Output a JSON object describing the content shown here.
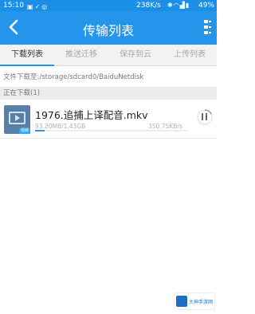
{
  "status_bar": {
    "time": "15:10",
    "network_rate": "238K/s",
    "battery": "49%",
    "left_icons": [
      "image-icon",
      "check-icon",
      "chat-icon"
    ],
    "right_icons": [
      "bluetooth-icon",
      "wifi-icon",
      "signal-icon",
      "battery-icon"
    ]
  },
  "header": {
    "title": "传输列表",
    "back_icon": "back-chevron-icon",
    "more_icon": "more-icon"
  },
  "tabs": [
    {
      "label": "下载列表",
      "active": true
    },
    {
      "label": "推送迁移",
      "active": false
    },
    {
      "label": "保存到云",
      "active": false
    },
    {
      "label": "上传列表",
      "active": false
    }
  ],
  "path_row": {
    "text": "文件下载至:/storage/sdcard0/BaiduNetdisk"
  },
  "section": {
    "title": "正在下载(1)"
  },
  "downloads": [
    {
      "filename": "1976.追捕上译配音.mkv",
      "progress_text": "93.20MB/1.43GB",
      "speed": "350.75KB/s",
      "progress": 0.06,
      "thumb_badge": "视频",
      "file_icon": "video-file-icon",
      "action_icon": "pause-icon"
    }
  ],
  "watermark": {
    "text": "大神手游网"
  },
  "colors": {
    "accent": "#2495ea",
    "status_bar": "#1b8fe6",
    "tab_bg": "#f2f2f2"
  }
}
